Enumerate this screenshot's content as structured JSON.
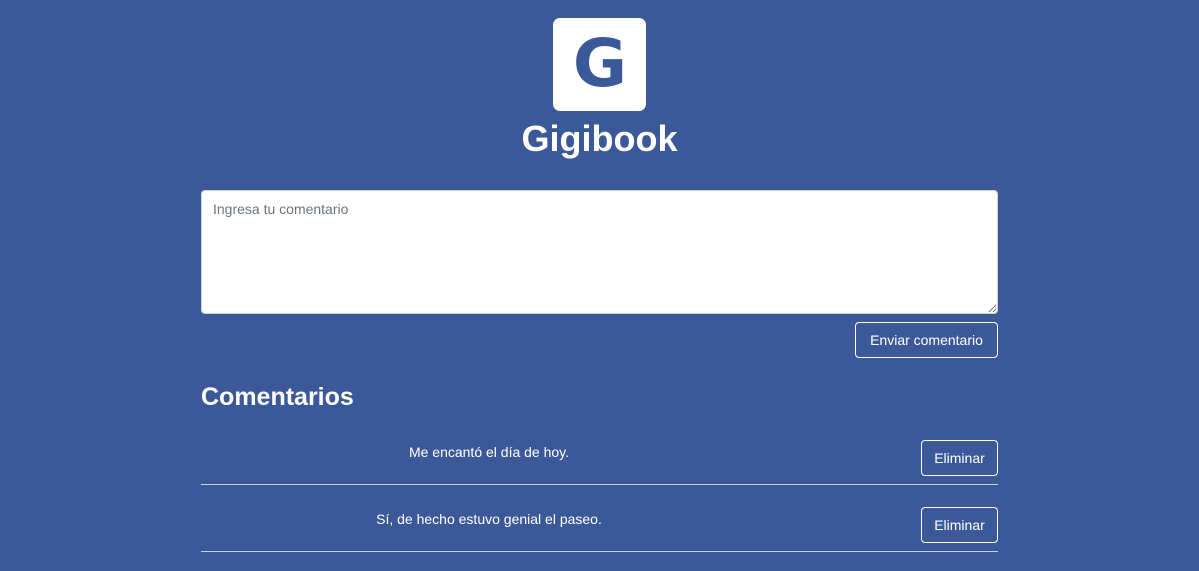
{
  "app": {
    "logo_letter": "G",
    "title": "Gigibook"
  },
  "composer": {
    "placeholder": "Ingresa tu comentario",
    "value": "",
    "submit_label": "Enviar comentario"
  },
  "comments_section": {
    "heading": "Comentarios",
    "items": [
      {
        "text": "Me encantó el día de hoy.",
        "delete_label": "Eliminar"
      },
      {
        "text": "Sí, de hecho estuvo genial el paseo.",
        "delete_label": "Eliminar"
      }
    ]
  },
  "colors": {
    "background": "#3b5998",
    "logo_background": "#ffffff",
    "logo_letter": "#3b5998",
    "text": "#ffffff"
  }
}
